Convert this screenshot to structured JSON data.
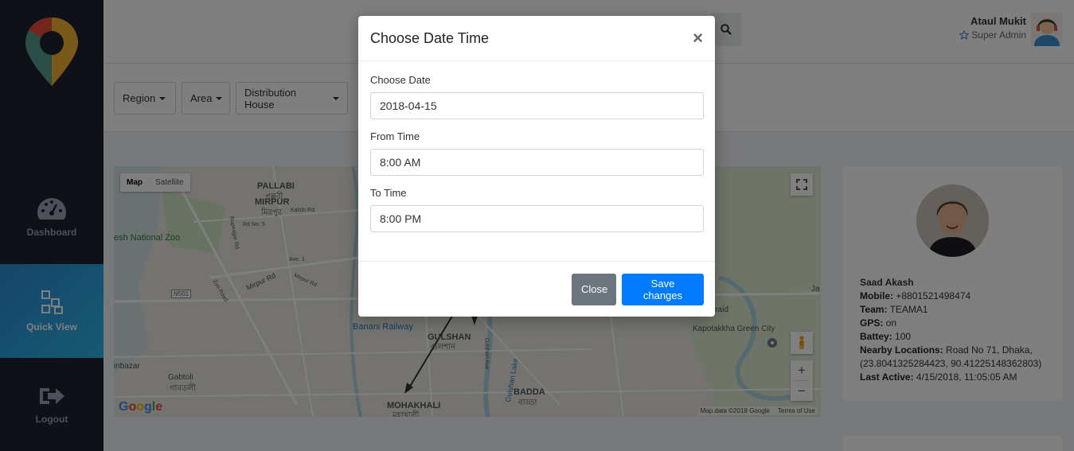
{
  "header": {
    "user_name": "Ataul Mukit",
    "user_role": "Super Admin"
  },
  "sidebar": {
    "items": [
      {
        "label": "Dashboard"
      },
      {
        "label": "Quick View"
      },
      {
        "label": "Logout"
      }
    ]
  },
  "filters": {
    "region": "Region",
    "area": "Area",
    "distribution_house": "Distribution House"
  },
  "map": {
    "type_map": "Map",
    "type_satellite": "Satellite",
    "google": "Google",
    "attribution": "Map data ©2018 Google",
    "terms": "Terms of Use",
    "labels": {
      "pallabi": "PALLABI",
      "pallabi_bn": "পল্লবী",
      "mirpur": "MIRPUR",
      "mirpur_bn": "মিরপুর",
      "national_zoo": "esh National Zoo",
      "banani_railway": "Banani Railway",
      "gulshan": "GULSHAN",
      "gulshan_bn": "গুলশান",
      "mohakhali": "MOHAKHALI",
      "mohakhali_bn": "মহাখালী",
      "badda": "BADDA",
      "badda_bn": "বাড্ডা",
      "beraid": "Beraid",
      "kapotakkha": "Kapotakkha Green City",
      "gabtoli": "Gabtoli",
      "gabtoli_bn": "গাবতলী",
      "inbazar": "inbazar",
      "ja": "Ja",
      "mirpur_rd": "Mirpur Rd",
      "kalshi_rd": "Kalshi Rd",
      "zoo_road": "Zoo Road",
      "n501": "N501",
      "gulshan_ave": "Gulshan Ave",
      "gulshan_lake": "Gulshan Lake",
      "ave_1": "Ave. 1",
      "rd_5": "Rd No. 5",
      "rupnagar_rd": "Rupnagar Rd"
    }
  },
  "profile": {
    "name": "Saad Akash",
    "mobile_label": "Mobile:",
    "mobile": "+8801521498474",
    "team_label": "Team:",
    "team": "TEAMA1",
    "gps_label": "GPS:",
    "gps": "on",
    "battery_label": "Battey:",
    "battery": "100",
    "nearby_label": "Nearby Locations:",
    "nearby": "Road No 71, Dhaka, (23.8041325284423, 90.41225148362803)",
    "last_active_label": "Last Active:",
    "last_active": "4/15/2018, 11:05:05 AM"
  },
  "modal": {
    "title": "Choose Date Time",
    "close_symbol": "×",
    "date_label": "Choose Date",
    "date_value": "2018-04-15",
    "from_label": "From Time",
    "from_value": "8:00 AM",
    "to_label": "To Time",
    "to_value": "8:00 PM",
    "close_button": "Close",
    "save_button": "Save changes"
  },
  "colors": {
    "sidebar_bg": "#1e2232",
    "active_nav": "#2a8bd6",
    "primary": "#007bff",
    "secondary": "#6c757d"
  }
}
